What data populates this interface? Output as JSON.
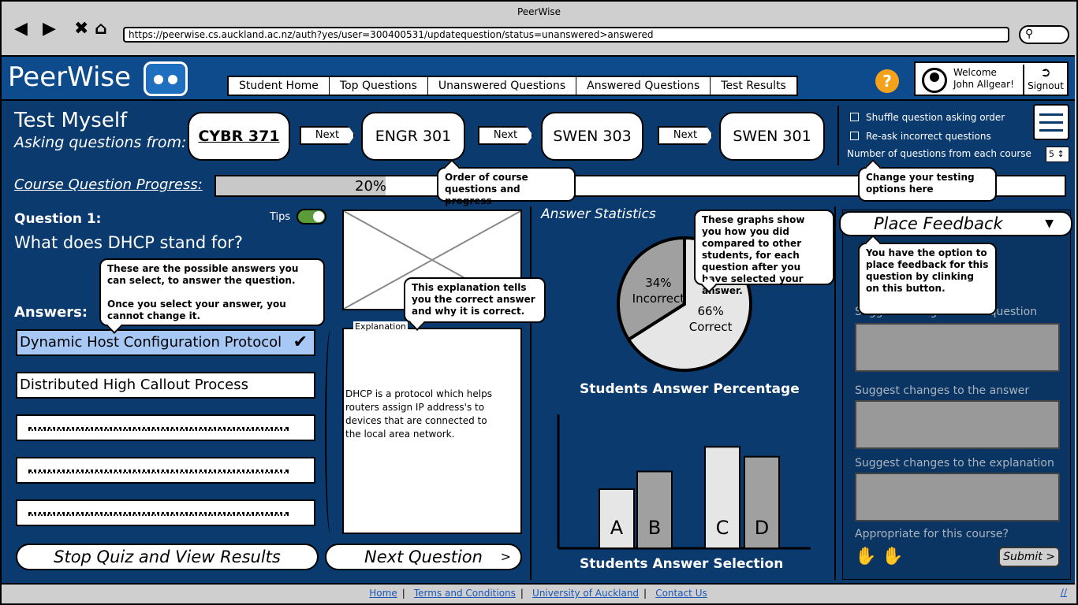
{
  "window": {
    "title": "PeerWise",
    "url": "https://peerwise.cs.auckland.ac.nz/auth?yes/user=300400531/updatequestion/status=unanswered>answered"
  },
  "browser_icons": {
    "back": "back-icon",
    "forward": "forward-icon",
    "close": "close-icon",
    "home": "home-icon",
    "search": "search-icon"
  },
  "header": {
    "logo": "PeerWise",
    "tabs": [
      "Student Home",
      "Top Questions",
      "Unanswered Questions",
      "Answered Questions",
      "Test Results"
    ],
    "help": "?",
    "welcome_line1": "Welcome",
    "welcome_line2": "John Allgear!",
    "signout": "Signout"
  },
  "test": {
    "title": "Test Myself",
    "subtitle": "Asking questions from:",
    "courses": [
      "CYBR 371",
      "ENGR 301",
      "SWEN 303",
      "SWEN 301"
    ],
    "next_label": "Next",
    "options": {
      "shuffle": "Shuffle question asking order",
      "reask": "Re-ask incorrect questions",
      "count_label": "Number of questions from each course",
      "count_value": "5"
    },
    "progress_label": "Course Question Progress:",
    "progress_percent": 20,
    "progress_text": "20%"
  },
  "question": {
    "title": "Question 1:",
    "text": "What does DHCP stand for?",
    "tips": "Tips",
    "answers_label": "Answers:",
    "answers": [
      "Dynamic Host Configuration Protocol",
      "Distributed High Callout Process"
    ],
    "explanation_legend": "Explanation",
    "explanation": "DHCP is a protocol which helps routers assign IP address's to devices that are connected to the local area network.",
    "stop_button": "Stop Quiz and View Results",
    "next_button": "Next Question",
    "next_chevron": ">"
  },
  "stats": {
    "title": "Answer Statistics",
    "pie_title": "Students Answer Percentage",
    "bar_title": "Students Answer Selection"
  },
  "chart_data": [
    {
      "type": "pie",
      "title": "Students Answer Percentage",
      "slices": [
        {
          "label": "Correct",
          "value": 66,
          "text": "66%",
          "color": "#e6e6e6"
        },
        {
          "label": "Incorrect",
          "value": 34,
          "text": "34%",
          "color": "#a0a0a0"
        }
      ]
    },
    {
      "type": "bar",
      "title": "Students Answer Selection",
      "categories": [
        "A",
        "B",
        "C",
        "D"
      ],
      "values": [
        6,
        7.8,
        10.3,
        9.3
      ],
      "colors": [
        "#e6e6e6",
        "#a0a0a0",
        "#e6e6e6",
        "#a0a0a0"
      ],
      "ylim": [
        0,
        12
      ]
    }
  ],
  "feedback": {
    "title": "Place Feedback",
    "caret": "▼",
    "label_question": "Suggest changes to the question",
    "label_answer": "Suggest changes to the answer",
    "label_explanation": "Suggest changes to the explanation",
    "appropriate": "Appropriate for this course?",
    "submit": "Submit",
    "submit_chevron": ">"
  },
  "callouts": {
    "answers": "These are the possible answers you can select, to answer the question.\n\nOnce you select your answer, you cannot change it.",
    "explanation": "This explanation tells you the correct answer and why it is correct.",
    "order": "Order of course questions and progress",
    "options": "Change your testing options here",
    "graphs": "These graphs show you how you did compared to other students, for each question after you have selected your answer.",
    "feedback": "You have the option to place feedback for this question by clinking on this button."
  },
  "footer": {
    "links": [
      "Home",
      "Terms and Conditions",
      "University of Auckland",
      "Contact Us"
    ]
  }
}
